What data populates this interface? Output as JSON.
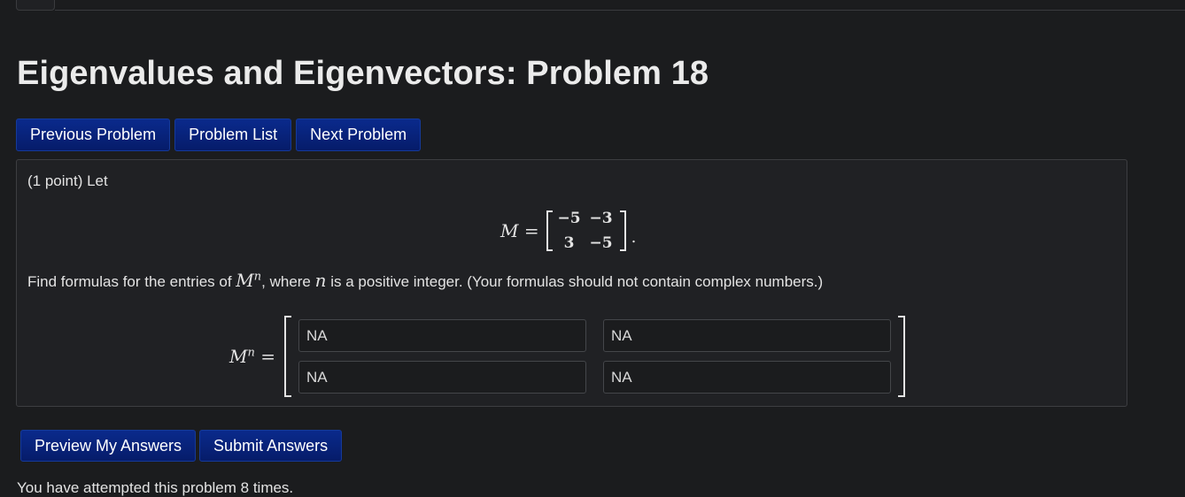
{
  "page": {
    "title": "Eigenvalues and Eigenvectors: Problem 18"
  },
  "nav": {
    "previous": "Previous Problem",
    "list": "Problem List",
    "next": "Next Problem"
  },
  "problem": {
    "intro": "(1 point) Let",
    "matrix_label": "M =",
    "matrix": [
      [
        "−5",
        "−3"
      ],
      [
        "3",
        "−5"
      ]
    ],
    "period": ".",
    "text_before": "Find formulas for the entries of ",
    "text_M": "M",
    "text_exp": "n",
    "text_mid": ", where ",
    "text_n": "n",
    "text_after": " is a positive integer. (Your formulas should not contain complex numbers.)",
    "answer_label_base": "M",
    "answer_label_exp": "n",
    "answer_label_eq": " =",
    "answers": [
      "NA",
      "NA",
      "NA",
      "NA"
    ]
  },
  "actions": {
    "preview": "Preview My Answers",
    "submit": "Submit Answers"
  },
  "status": {
    "attempts": "You have attempted this problem 8 times."
  },
  "colors": {
    "background": "#1b1c1e",
    "panel": "#202124",
    "button": "#0a2a8c",
    "text": "#e3e3e3"
  }
}
